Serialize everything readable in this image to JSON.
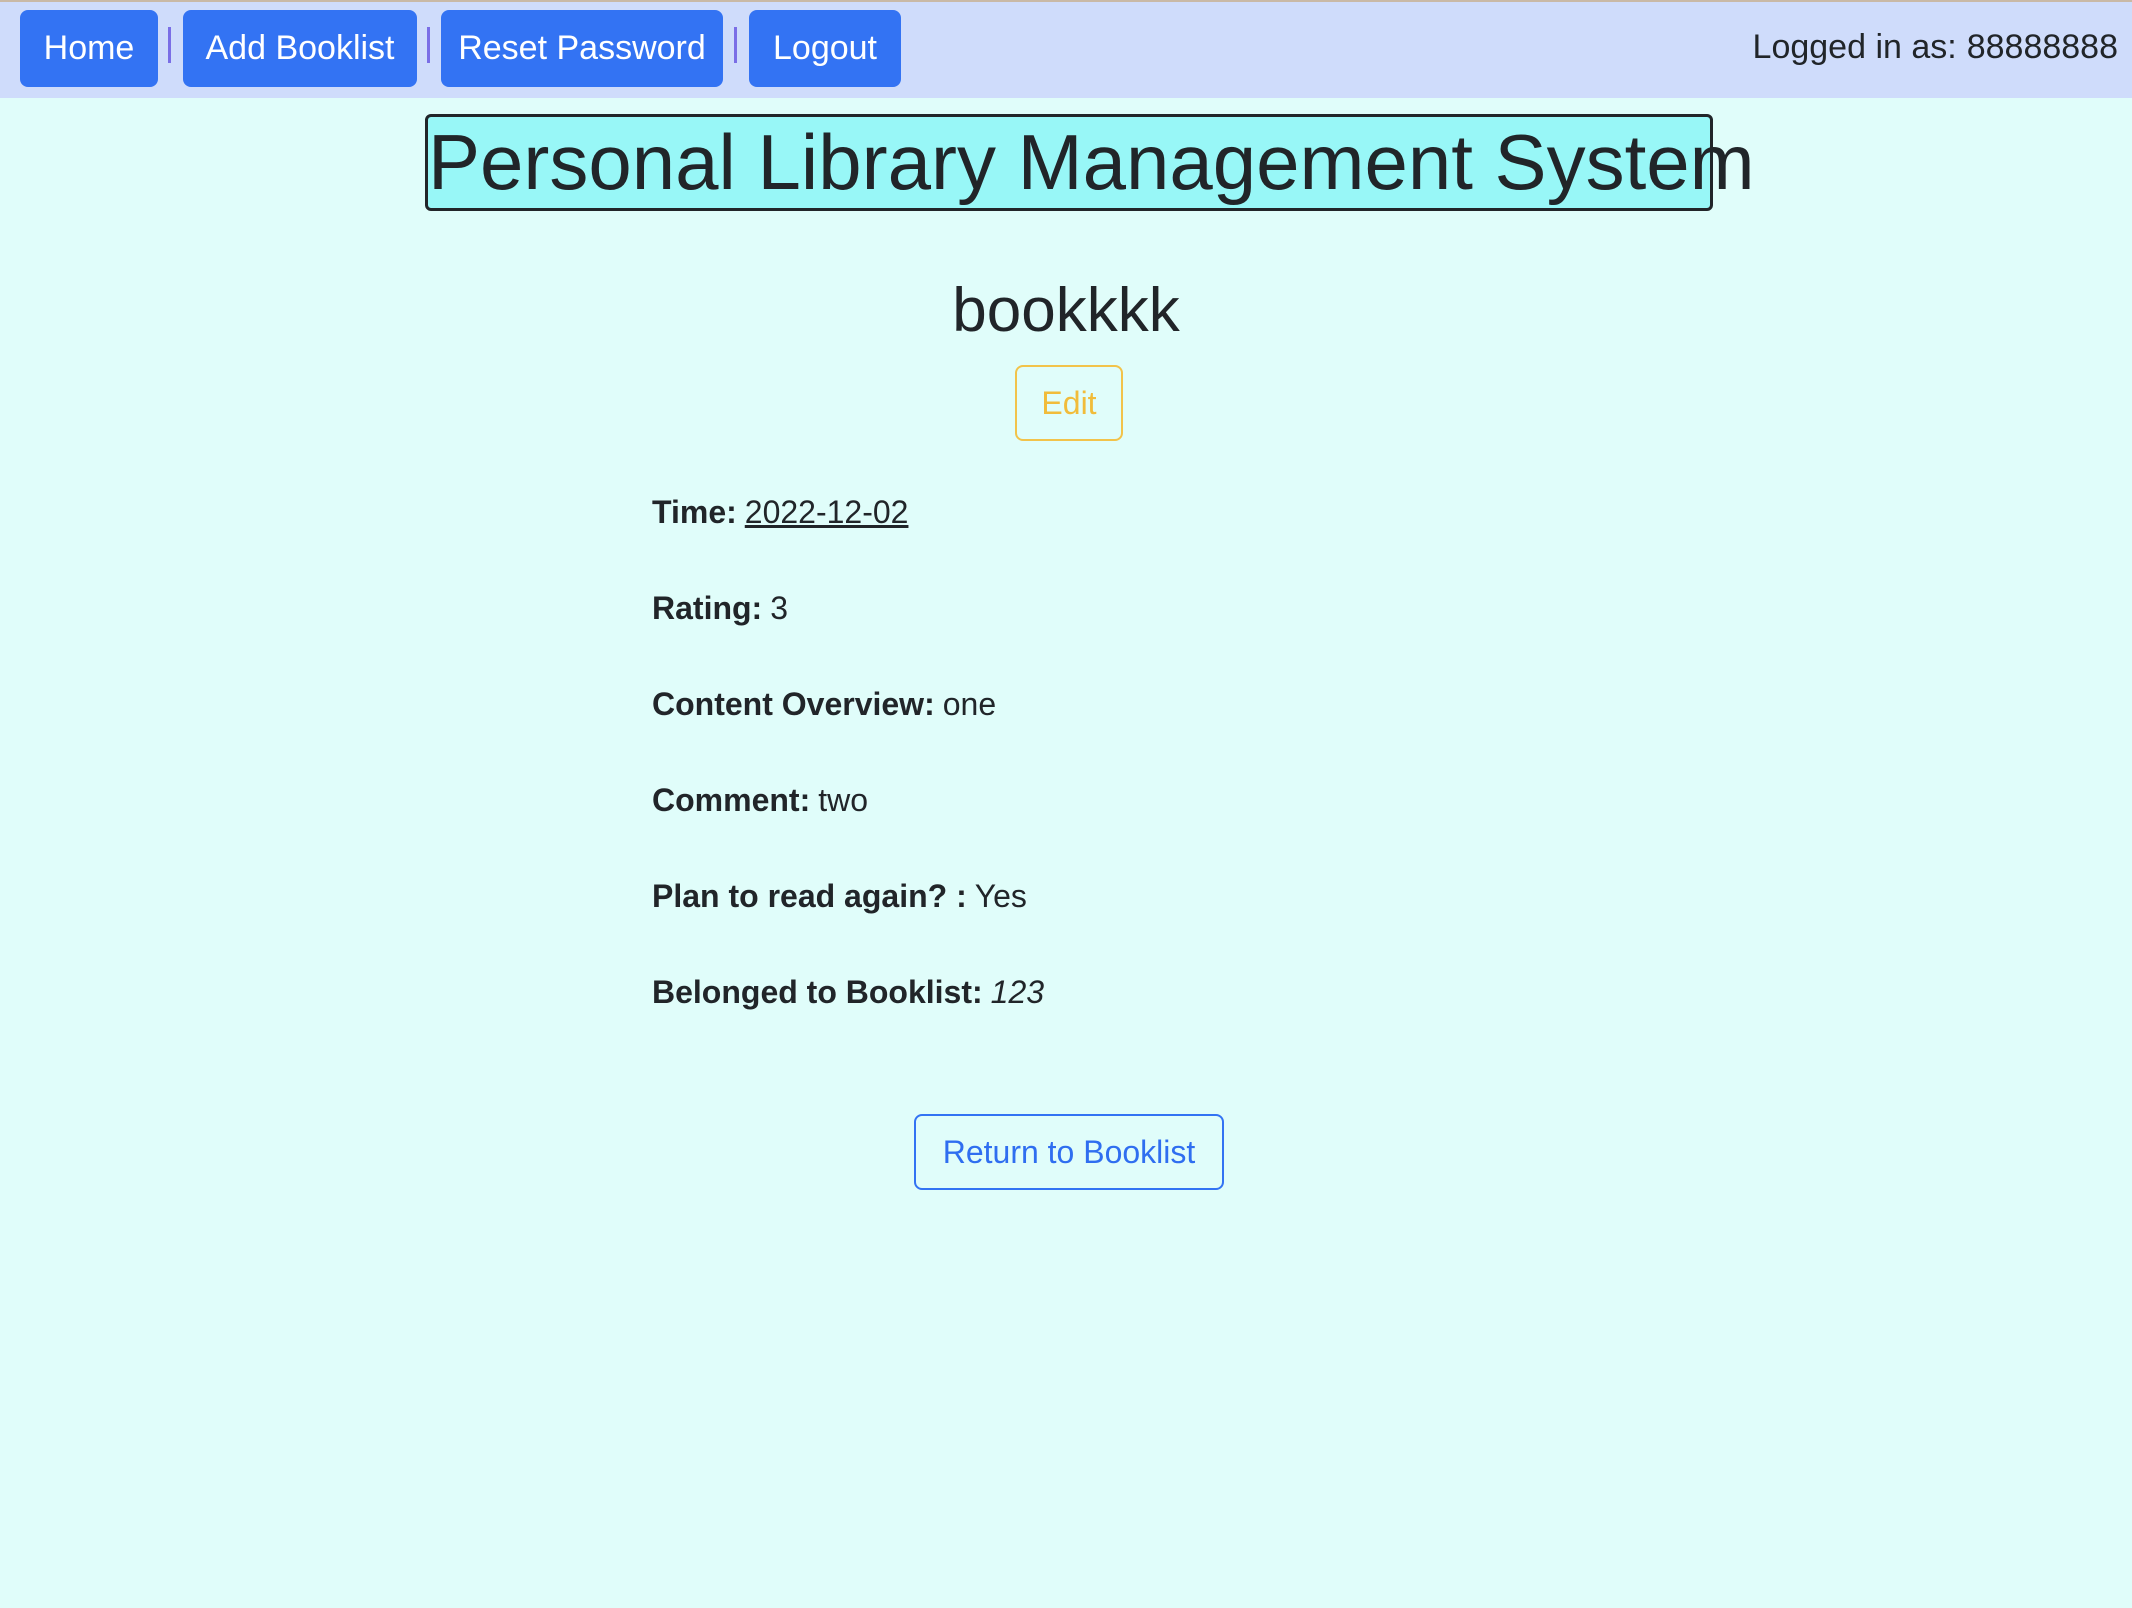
{
  "nav": {
    "home_label": "Home",
    "add_booklist_label": "Add Booklist",
    "reset_password_label": "Reset Password",
    "logout_label": "Logout",
    "separator": "|",
    "logged_in_label": "Logged in as:",
    "username": "88888888"
  },
  "header": {
    "site_title": "Personal Library Management System"
  },
  "book": {
    "title": "bookkkk",
    "edit_label": "Edit",
    "details": [
      {
        "label": "Time:",
        "value": "2022-12-02"
      },
      {
        "label": "Rating:",
        "value": "3"
      },
      {
        "label": "Content Overview:",
        "value": "one"
      },
      {
        "label": "Comment:",
        "value": "two"
      },
      {
        "label": "Plan to read again? :",
        "value": "Yes"
      },
      {
        "label": "Belonged to Booklist:",
        "value": "123"
      }
    ],
    "return_label": "Return to Booklist"
  },
  "colors": {
    "nav_bg": "#cfdcfb",
    "nav_button": "#3373f3",
    "page_bg": "#e0fdfa",
    "title_bg": "#98f7f7",
    "edit_accent": "#f1bc3a",
    "return_accent": "#3373f3"
  }
}
